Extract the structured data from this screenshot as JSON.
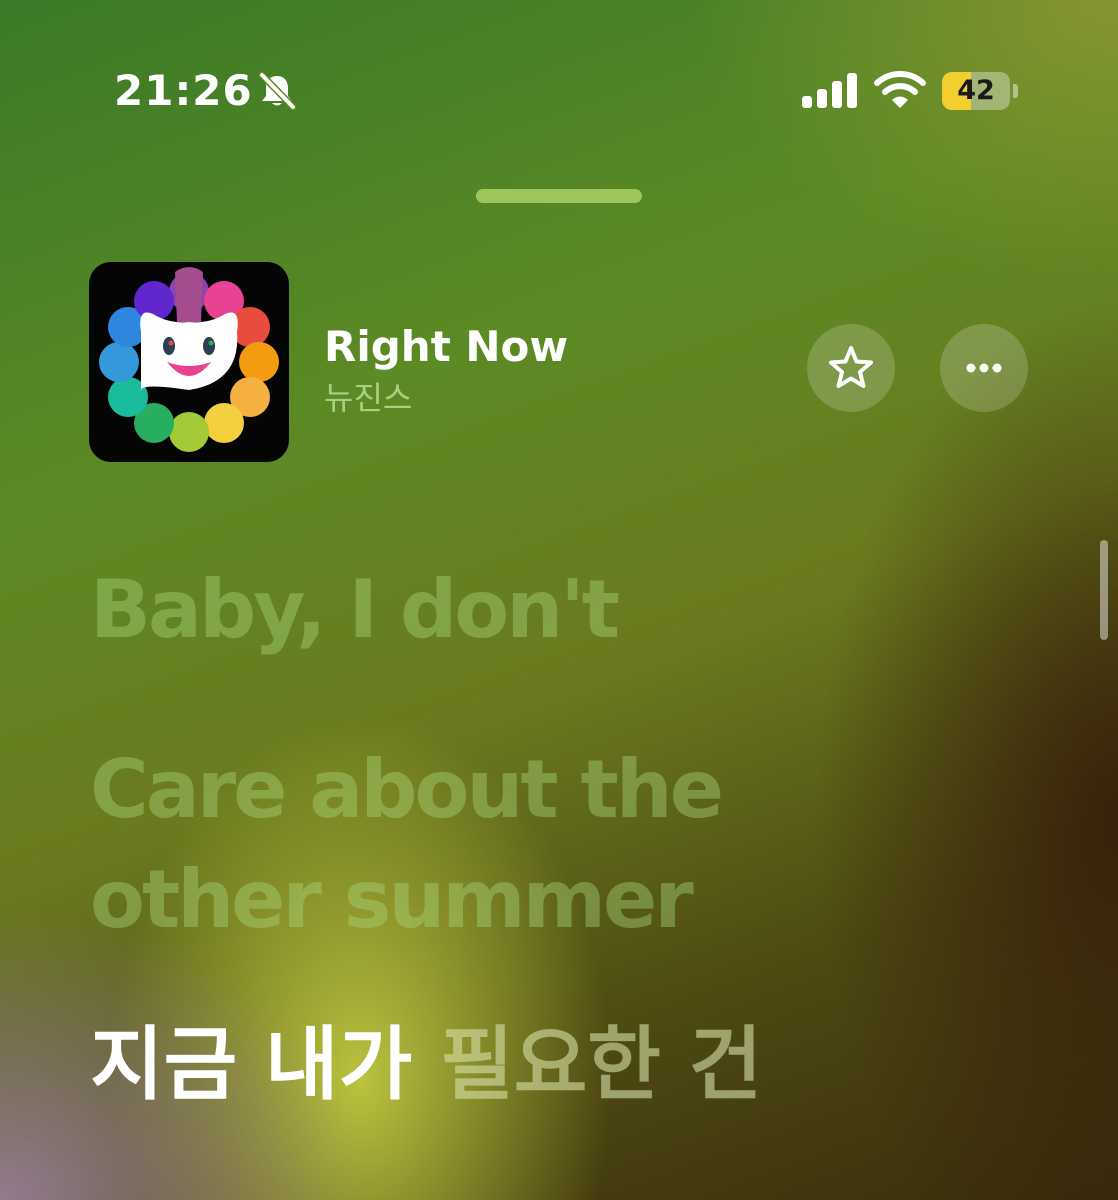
{
  "status_bar": {
    "time": "21:26",
    "mute_icon": "bell-slash-icon",
    "signal_icon": "cellular-signal-icon",
    "wifi_icon": "wifi-icon",
    "battery_level": "42",
    "battery_fraction": 0.42,
    "battery_color": "#f2cf2f"
  },
  "now_playing": {
    "title": "Right Now",
    "artist": "뉴진스",
    "artwork_icon": "rainbow-flower-artwork",
    "favorite_icon": "star-icon",
    "more_icon": "ellipsis-icon"
  },
  "lyrics": {
    "past_lines": [
      "Baby, I don't",
      "Care about the\nother summer"
    ],
    "current_line": {
      "sung": "지금 내가 ",
      "unsung": "필요한 건"
    }
  },
  "colors": {
    "accent_green": "#9fc65a",
    "current_lyric": "#ffffff"
  }
}
